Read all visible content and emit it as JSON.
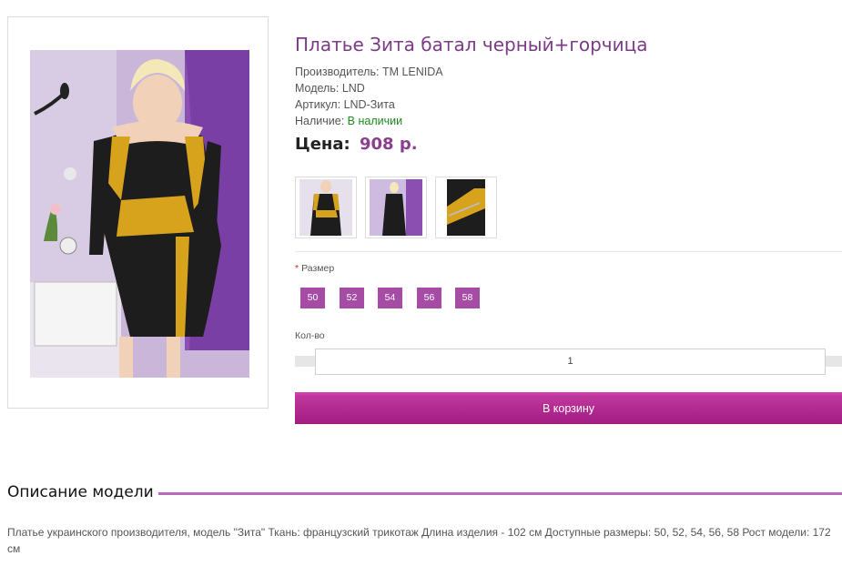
{
  "product": {
    "title": "Платье Зита батал черный+горчица",
    "manufacturer_label": "Производитель:",
    "manufacturer_value": "ТМ LENIDA",
    "model_label": "Модель:",
    "model_value": "LND",
    "sku_label": "Артикул:",
    "sku_value": "LND-Зита",
    "availability_label": "Наличие:",
    "availability_value": "В наличии",
    "price_label": "Цена:",
    "price_value": "908 р."
  },
  "options": {
    "size_label": "Размер",
    "required_mark": "*",
    "sizes": [
      "50",
      "52",
      "54",
      "56",
      "58"
    ]
  },
  "quantity": {
    "label": "Кол-во",
    "value": "1"
  },
  "cart": {
    "button_label": "В корзину"
  },
  "description": {
    "heading": "Описание модели",
    "text": "Платье украинского производителя, модель \"Зита\" Ткань: французский трикотаж Длина изделия - 102 см Доступные размеры: 50, 52, 54, 56, 58 Рост модели: 172 см"
  },
  "colors": {
    "accent": "#8a3e8e",
    "size_bg": "#a64ca5",
    "cart_bg": "#b22a91",
    "in_stock": "#1c8a1c",
    "dress_black": "#1d1d1d",
    "dress_mustard": "#d8a31c",
    "backdrop_purple": "#9b6bb8"
  }
}
